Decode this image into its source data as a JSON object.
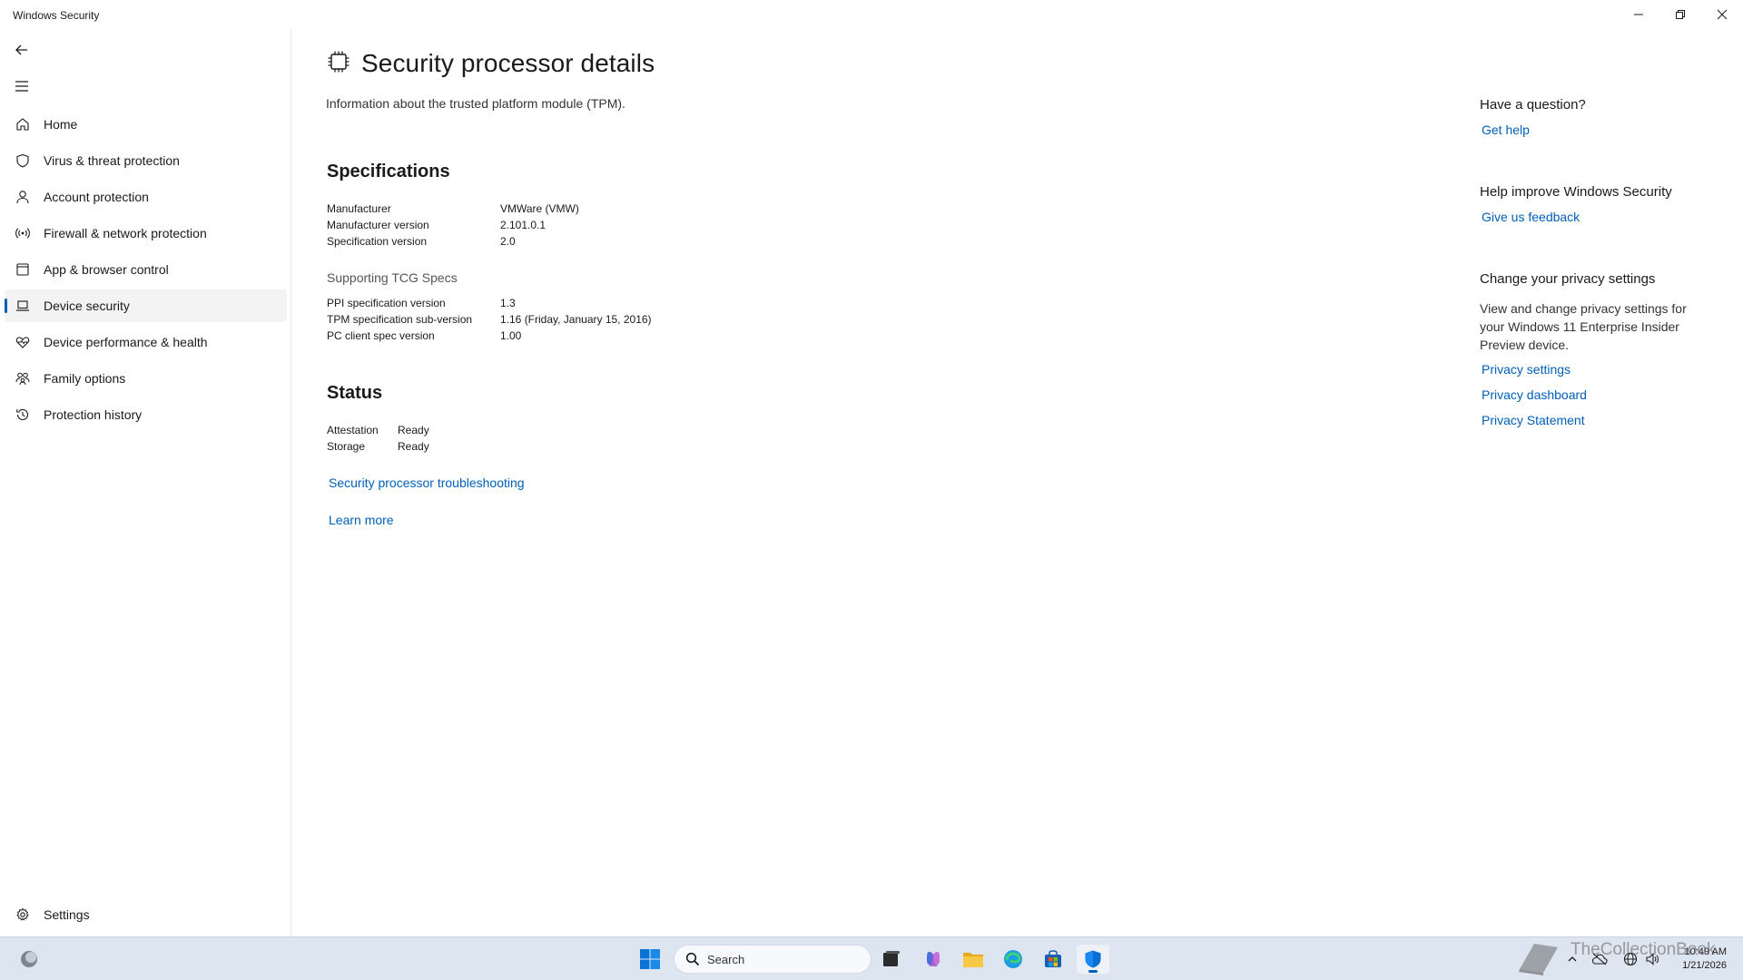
{
  "window": {
    "title": "Windows Security"
  },
  "sidebar": {
    "items": [
      {
        "label": "Home",
        "icon": "home-icon"
      },
      {
        "label": "Virus & threat protection",
        "icon": "shield-icon"
      },
      {
        "label": "Account protection",
        "icon": "person-icon"
      },
      {
        "label": "Firewall & network protection",
        "icon": "wifi-icon"
      },
      {
        "label": "App & browser control",
        "icon": "app-window-icon"
      },
      {
        "label": "Device security",
        "icon": "laptop-icon",
        "active": true
      },
      {
        "label": "Device performance & health",
        "icon": "heart-icon"
      },
      {
        "label": "Family options",
        "icon": "family-icon"
      },
      {
        "label": "Protection history",
        "icon": "history-icon"
      }
    ],
    "settings_label": "Settings"
  },
  "main": {
    "title": "Security processor details",
    "description": "Information about the trusted platform module (TPM).",
    "specifications": {
      "heading": "Specifications",
      "rows": [
        {
          "key": "Manufacturer",
          "value": "VMWare (VMW)"
        },
        {
          "key": "Manufacturer version",
          "value": "2.101.0.1"
        },
        {
          "key": "Specification version",
          "value": "2.0"
        }
      ]
    },
    "tcg": {
      "heading": "Supporting TCG Specs",
      "rows": [
        {
          "key": "PPI specification version",
          "value": "1.3"
        },
        {
          "key": "TPM specification sub-version",
          "value": "1.16 (Friday, January 15, 2016)"
        },
        {
          "key": "PC client spec version",
          "value": "1.00"
        }
      ]
    },
    "status": {
      "heading": "Status",
      "rows": [
        {
          "key": "Attestation",
          "value": "Ready"
        },
        {
          "key": "Storage",
          "value": "Ready"
        }
      ]
    },
    "troubleshooting_link": "Security processor troubleshooting",
    "learn_more_link": "Learn more"
  },
  "rail": {
    "question_heading": "Have a question?",
    "get_help": "Get help",
    "improve_heading": "Help improve Windows Security",
    "feedback": "Give us feedback",
    "privacy_heading": "Change your privacy settings",
    "privacy_text": "View and change privacy settings for your Windows 11 Enterprise Insider Preview device.",
    "privacy_settings": "Privacy settings",
    "privacy_dashboard": "Privacy dashboard",
    "privacy_statement": "Privacy Statement"
  },
  "taskbar": {
    "search_placeholder": "Search",
    "time": "10:49 AM",
    "date": "1/21/2026",
    "accent": "#005fb8"
  },
  "watermark": "TheCollectionBook"
}
